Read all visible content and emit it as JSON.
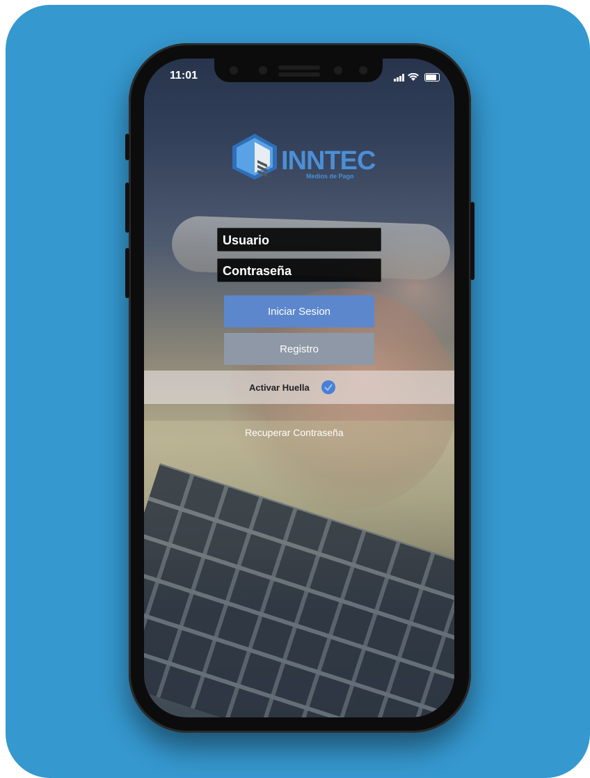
{
  "status_bar": {
    "time": "11:01",
    "icons": [
      "signal-icon",
      "wifi-icon",
      "battery-icon"
    ]
  },
  "brand": {
    "name": "INNTEC",
    "tagline": "Medios de Pago",
    "color": "#4b8fd6"
  },
  "login": {
    "username_placeholder": "Usuario",
    "password_placeholder": "Contraseña",
    "login_button": "Iniciar Sesion",
    "register_button": "Registro",
    "fingerprint_label": "Activar Huella",
    "fingerprint_enabled": true,
    "recover_link": "Recuperar Contraseña"
  },
  "colors": {
    "background": "#3598cf",
    "login_button": "#5c87cc",
    "register_button": "#8e98a6"
  }
}
